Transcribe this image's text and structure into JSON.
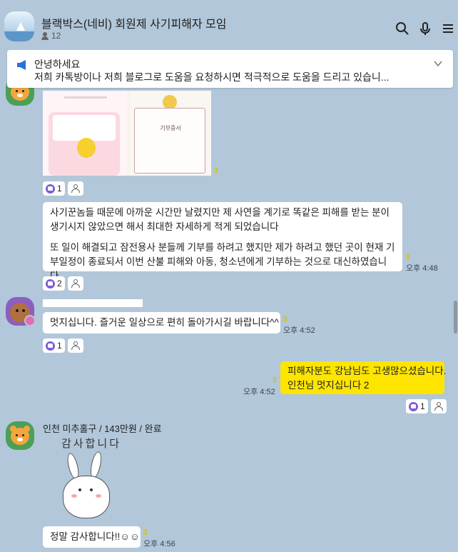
{
  "header": {
    "title": "블랙박스(네비) 회원제 사기피해자 모임",
    "member_count": "12",
    "icons": [
      "search-icon",
      "microphone-icon",
      "menu-icon"
    ]
  },
  "notice": {
    "title": "안녕하세요",
    "body": "저희 카톡방이나 저희 블로그로 도움을 요청하시면 적극적으로 도움을 드리고 있습니..."
  },
  "image_message": {
    "cert_title": "기부증서",
    "unread": "3",
    "reactions": {
      "like_count": "1"
    }
  },
  "messages": [
    {
      "id": "long-message",
      "paragraph1": "사기꾼놈들 때문에 아까운 시간만 날렸지만 제 사연을 계기로 똑같은 피해를 받는 분이 생기시지 않았으면 해서 최대한 자세하게 적게 되었습니다",
      "paragraph2": "또 일이 해결되고 잠전용사 분들께 기부를 하려고 했지만 제가 하려고 했던 곳이 현재 기부일정이 종료되서 이번 산불 피해와 아동, 청소년에게 기부하는 것으로 대신하였습니다",
      "unread": "3",
      "time": "오후 4:48",
      "like_count": "2"
    },
    {
      "id": "wish-message",
      "text": "멋지십니다. 즐거운 일상으로 편히 돌아가시길 바랍니다^^",
      "unread": "3",
      "time": "오후 4:52",
      "like_count": "1"
    },
    {
      "id": "my-message",
      "line1": "피해자분도 강남님도 고생많으셨습니다.",
      "line2": "인천님 멋지십니다 2",
      "unread": "3",
      "time": "오후 4:52",
      "like_count": "1"
    },
    {
      "id": "thanks-sender",
      "sender": "인천 미추홀구 / 143만원 / 완료",
      "sticker_text": "감사합니다",
      "text": "정말 감사합니다!!☺☺",
      "unread": "3",
      "time": "오후 4:56"
    }
  ],
  "colors": {
    "background": "#b2c7d9",
    "my_bubble": "#fee500",
    "like": "#7e5bd6",
    "unread": "#d9c100"
  }
}
